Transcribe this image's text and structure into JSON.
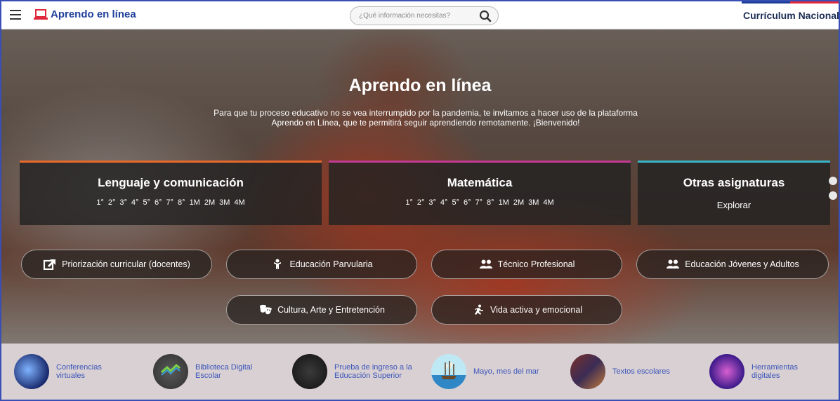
{
  "header": {
    "logo_text": "Aprendo en línea",
    "search_placeholder": "¿Qué información necesitas?",
    "brand": "Currículum Nacional"
  },
  "hero": {
    "title": "Aprendo en línea",
    "subtitle": "Para que tu proceso educativo no se vea interrumpido por la pandemia, te invitamos a hacer uso de la plataforma Aprendo en Línea, que te permitirá seguir aprendiendo remotamente. ¡Bienvenido!"
  },
  "cards": [
    {
      "title": "Lenguaje y comunicación",
      "grades": [
        "1°",
        "2°",
        "3°",
        "4°",
        "5°",
        "6°",
        "7°",
        "8°",
        "1M",
        "2M",
        "3M",
        "4M"
      ],
      "accent": "#e9692c"
    },
    {
      "title": "Matemática",
      "grades": [
        "1°",
        "2°",
        "3°",
        "4°",
        "5°",
        "6°",
        "7°",
        "8°",
        "1M",
        "2M",
        "3M",
        "4M"
      ],
      "accent": "#c23a91"
    },
    {
      "title": "Otras asignaturas",
      "link": "Explorar",
      "accent": "#37b6c8"
    }
  ],
  "buttons": [
    {
      "label": "Priorización curricular (docentes)",
      "icon": "external-link-icon"
    },
    {
      "label": "Educación Parvularia",
      "icon": "child-icon"
    },
    {
      "label": "Técnico Profesional",
      "icon": "users-icon"
    },
    {
      "label": "Educación Jóvenes y Adultos",
      "icon": "users-icon"
    },
    {
      "label": "Cultura, Arte y Entretención",
      "icon": "theater-masks-icon"
    },
    {
      "label": "Vida activa y emocional",
      "icon": "running-icon"
    }
  ],
  "strip": [
    {
      "label": "Conferencias virtuales"
    },
    {
      "label": "Biblioteca Digital Escolar"
    },
    {
      "label": "Prueba de ingreso a la Educación Superior"
    },
    {
      "label": "Mayo, mes del mar"
    },
    {
      "label": "Textos escolares"
    },
    {
      "label": "Herramientas digitales"
    }
  ],
  "colors": {
    "brand_blue": "#1f3f9a",
    "link_blue": "#3a55b8",
    "lenguaje": "#e9692c",
    "matematica": "#c23a91",
    "otras": "#37b6c8"
  }
}
